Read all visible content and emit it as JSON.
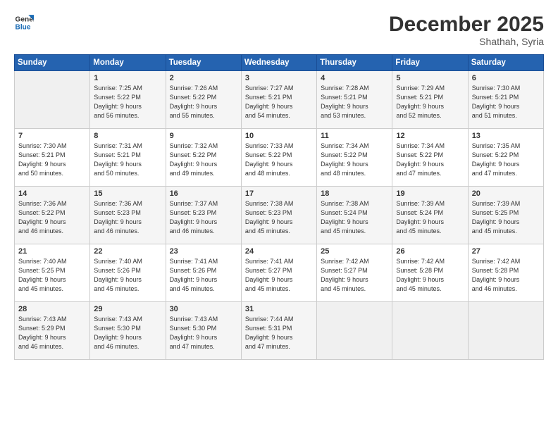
{
  "header": {
    "logo_line1": "General",
    "logo_line2": "Blue",
    "month": "December 2025",
    "location": "Shathah, Syria"
  },
  "weekdays": [
    "Sunday",
    "Monday",
    "Tuesday",
    "Wednesday",
    "Thursday",
    "Friday",
    "Saturday"
  ],
  "weeks": [
    [
      {
        "day": "",
        "info": ""
      },
      {
        "day": "1",
        "info": "Sunrise: 7:25 AM\nSunset: 5:22 PM\nDaylight: 9 hours\nand 56 minutes."
      },
      {
        "day": "2",
        "info": "Sunrise: 7:26 AM\nSunset: 5:22 PM\nDaylight: 9 hours\nand 55 minutes."
      },
      {
        "day": "3",
        "info": "Sunrise: 7:27 AM\nSunset: 5:21 PM\nDaylight: 9 hours\nand 54 minutes."
      },
      {
        "day": "4",
        "info": "Sunrise: 7:28 AM\nSunset: 5:21 PM\nDaylight: 9 hours\nand 53 minutes."
      },
      {
        "day": "5",
        "info": "Sunrise: 7:29 AM\nSunset: 5:21 PM\nDaylight: 9 hours\nand 52 minutes."
      },
      {
        "day": "6",
        "info": "Sunrise: 7:30 AM\nSunset: 5:21 PM\nDaylight: 9 hours\nand 51 minutes."
      }
    ],
    [
      {
        "day": "7",
        "info": "Sunrise: 7:30 AM\nSunset: 5:21 PM\nDaylight: 9 hours\nand 50 minutes."
      },
      {
        "day": "8",
        "info": "Sunrise: 7:31 AM\nSunset: 5:21 PM\nDaylight: 9 hours\nand 50 minutes."
      },
      {
        "day": "9",
        "info": "Sunrise: 7:32 AM\nSunset: 5:22 PM\nDaylight: 9 hours\nand 49 minutes."
      },
      {
        "day": "10",
        "info": "Sunrise: 7:33 AM\nSunset: 5:22 PM\nDaylight: 9 hours\nand 48 minutes."
      },
      {
        "day": "11",
        "info": "Sunrise: 7:34 AM\nSunset: 5:22 PM\nDaylight: 9 hours\nand 48 minutes."
      },
      {
        "day": "12",
        "info": "Sunrise: 7:34 AM\nSunset: 5:22 PM\nDaylight: 9 hours\nand 47 minutes."
      },
      {
        "day": "13",
        "info": "Sunrise: 7:35 AM\nSunset: 5:22 PM\nDaylight: 9 hours\nand 47 minutes."
      }
    ],
    [
      {
        "day": "14",
        "info": "Sunrise: 7:36 AM\nSunset: 5:22 PM\nDaylight: 9 hours\nand 46 minutes."
      },
      {
        "day": "15",
        "info": "Sunrise: 7:36 AM\nSunset: 5:23 PM\nDaylight: 9 hours\nand 46 minutes."
      },
      {
        "day": "16",
        "info": "Sunrise: 7:37 AM\nSunset: 5:23 PM\nDaylight: 9 hours\nand 46 minutes."
      },
      {
        "day": "17",
        "info": "Sunrise: 7:38 AM\nSunset: 5:23 PM\nDaylight: 9 hours\nand 45 minutes."
      },
      {
        "day": "18",
        "info": "Sunrise: 7:38 AM\nSunset: 5:24 PM\nDaylight: 9 hours\nand 45 minutes."
      },
      {
        "day": "19",
        "info": "Sunrise: 7:39 AM\nSunset: 5:24 PM\nDaylight: 9 hours\nand 45 minutes."
      },
      {
        "day": "20",
        "info": "Sunrise: 7:39 AM\nSunset: 5:25 PM\nDaylight: 9 hours\nand 45 minutes."
      }
    ],
    [
      {
        "day": "21",
        "info": "Sunrise: 7:40 AM\nSunset: 5:25 PM\nDaylight: 9 hours\nand 45 minutes."
      },
      {
        "day": "22",
        "info": "Sunrise: 7:40 AM\nSunset: 5:26 PM\nDaylight: 9 hours\nand 45 minutes."
      },
      {
        "day": "23",
        "info": "Sunrise: 7:41 AM\nSunset: 5:26 PM\nDaylight: 9 hours\nand 45 minutes."
      },
      {
        "day": "24",
        "info": "Sunrise: 7:41 AM\nSunset: 5:27 PM\nDaylight: 9 hours\nand 45 minutes."
      },
      {
        "day": "25",
        "info": "Sunrise: 7:42 AM\nSunset: 5:27 PM\nDaylight: 9 hours\nand 45 minutes."
      },
      {
        "day": "26",
        "info": "Sunrise: 7:42 AM\nSunset: 5:28 PM\nDaylight: 9 hours\nand 45 minutes."
      },
      {
        "day": "27",
        "info": "Sunrise: 7:42 AM\nSunset: 5:28 PM\nDaylight: 9 hours\nand 46 minutes."
      }
    ],
    [
      {
        "day": "28",
        "info": "Sunrise: 7:43 AM\nSunset: 5:29 PM\nDaylight: 9 hours\nand 46 minutes."
      },
      {
        "day": "29",
        "info": "Sunrise: 7:43 AM\nSunset: 5:30 PM\nDaylight: 9 hours\nand 46 minutes."
      },
      {
        "day": "30",
        "info": "Sunrise: 7:43 AM\nSunset: 5:30 PM\nDaylight: 9 hours\nand 47 minutes."
      },
      {
        "day": "31",
        "info": "Sunrise: 7:44 AM\nSunset: 5:31 PM\nDaylight: 9 hours\nand 47 minutes."
      },
      {
        "day": "",
        "info": ""
      },
      {
        "day": "",
        "info": ""
      },
      {
        "day": "",
        "info": ""
      }
    ]
  ]
}
